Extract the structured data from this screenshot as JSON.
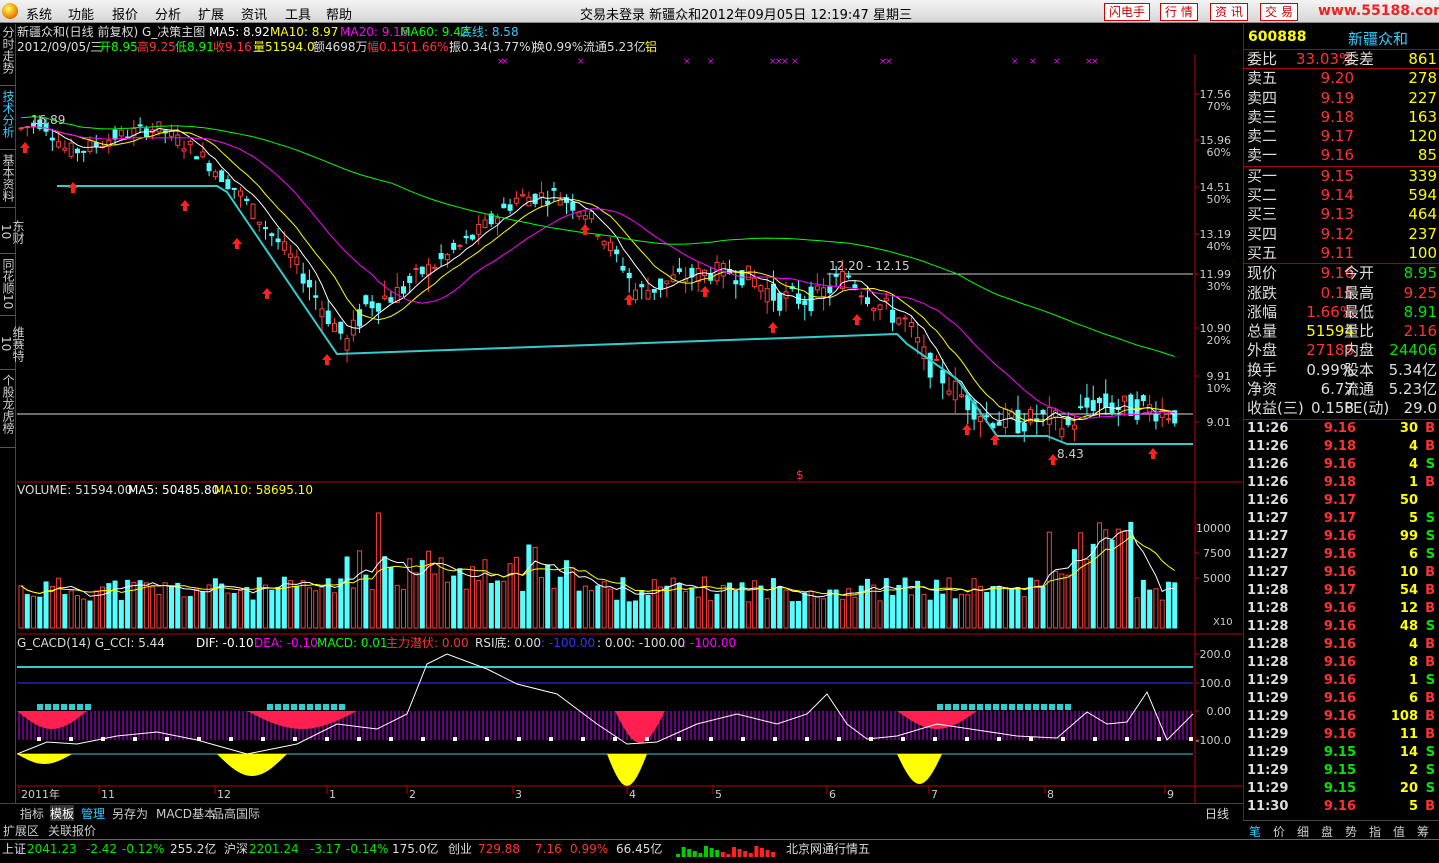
{
  "window": {
    "title": "交易未登录   新疆众和2012年09月05日  12:19:47  星期三"
  },
  "menu": [
    "系统",
    "功能",
    "报价",
    "分析",
    "扩展",
    "资讯",
    "工具",
    "帮助"
  ],
  "top_buttons": [
    "闪电手",
    "行  情",
    "资  讯",
    "交  易"
  ],
  "watermark": "www.55188.com",
  "left_tabs": [
    "分时走势",
    "技术分析",
    "基本资料",
    "东财10",
    "同花顺10",
    "维赛特10",
    "个股龙虎榜"
  ],
  "header": {
    "line1_prefix": "新疆众和(日线 前复权) G_决策主图",
    "ma5": "MA5: 8.92",
    "ma10": "MA10: 8.97",
    "ma20": "MA20: 9.16",
    "ma60": "MA60: 9.42",
    "bottom": "底线: 8.58",
    "line2_date": "2012/09/05/三",
    "open": "开8.95",
    "high": "高9.25",
    "low": "低8.91",
    "close": "收9.16",
    "vol": "量51594.0",
    "amt": "额4698万",
    "range": "幅0.15(1.66%)",
    "amp": "振0.34(3.77%)",
    "turn": "换0.99%",
    "float": "流通5.23亿",
    "alum": "铝"
  },
  "chart_data": [
    {
      "type": "candlestick",
      "title": "新疆众和(日线 前复权) G_决策主图",
      "y_ticks": [
        "17.56",
        "15.96",
        "14.51",
        "13.19",
        "11.99",
        "10.90",
        "9.91",
        "9.01"
      ],
      "pct_ticks": [
        "70%",
        "60%",
        "50%",
        "40%",
        "30%",
        "20%",
        "10%"
      ],
      "annotations": [
        "16.89",
        "12.20 - 12.15",
        "8.43",
        "$"
      ],
      "x_ticks": [
        "2011年",
        "11",
        "12",
        "1",
        "2",
        "3",
        "4",
        "5",
        "6",
        "7",
        "8",
        "9"
      ],
      "ma": [
        "MA5",
        "MA10",
        "MA20",
        "MA60"
      ]
    },
    {
      "type": "bar",
      "title": "VOLUME: 51594.00",
      "labels": [
        "MA5: 50485.80",
        "MA10: 58695.10"
      ],
      "y_ticks": [
        "10000",
        "7500",
        "5000"
      ],
      "scale": "X10"
    },
    {
      "type": "line",
      "title": "G_CACD(14)  G_CCI: 5.44",
      "labels": [
        "DIF: -0.10",
        "DEA: -0.10",
        "MACD: 0.01",
        "主力潜伏: 0.00",
        "RSI底: 0.00",
        ": -100.00",
        ": 0.00",
        ": -100.00",
        ": -100.00"
      ],
      "y_ticks": [
        "200.0",
        "100.0",
        "0.00",
        "-100.0"
      ]
    }
  ],
  "right_panel": {
    "code": "600888",
    "name": "新疆众和",
    "weibi": {
      "l1": "委比",
      "v1": "33.03%",
      "l2": "委差",
      "v2": "861"
    },
    "asks": [
      [
        "卖五",
        "9.20",
        "278"
      ],
      [
        "卖四",
        "9.19",
        "227"
      ],
      [
        "卖三",
        "9.18",
        "163"
      ],
      [
        "卖二",
        "9.17",
        "120"
      ],
      [
        "卖一",
        "9.16",
        "85"
      ]
    ],
    "bids": [
      [
        "买一",
        "9.15",
        "339"
      ],
      [
        "买二",
        "9.14",
        "594"
      ],
      [
        "买三",
        "9.13",
        "464"
      ],
      [
        "买四",
        "9.12",
        "237"
      ],
      [
        "买五",
        "9.11",
        "100"
      ]
    ],
    "stats": [
      [
        "现价",
        "9.16",
        "今开",
        "8.95"
      ],
      [
        "涨跌",
        "0.15",
        "最高",
        "9.25"
      ],
      [
        "涨幅",
        "1.66%",
        "最低",
        "8.91"
      ],
      [
        "总量",
        "51594",
        "量比",
        "2.16"
      ],
      [
        "外盘",
        "27188",
        "内盘",
        "24406"
      ],
      [
        "换手",
        "0.99%",
        "股本",
        "5.34亿"
      ],
      [
        "净资",
        "6.77",
        "流通",
        "5.23亿"
      ],
      [
        "收益(三)",
        "0.158",
        "PE(动)",
        "29.0"
      ]
    ],
    "ticks": [
      [
        "11:26",
        "9.16",
        "30",
        "B"
      ],
      [
        "11:26",
        "9.18",
        "4",
        "B"
      ],
      [
        "11:26",
        "9.16",
        "4",
        "S"
      ],
      [
        "11:26",
        "9.18",
        "1",
        "B"
      ],
      [
        "11:26",
        "9.17",
        "50",
        ""
      ],
      [
        "11:27",
        "9.17",
        "5",
        "S"
      ],
      [
        "11:27",
        "9.16",
        "99",
        "S"
      ],
      [
        "11:27",
        "9.16",
        "6",
        "S"
      ],
      [
        "11:27",
        "9.16",
        "10",
        "B"
      ],
      [
        "11:28",
        "9.17",
        "54",
        "B"
      ],
      [
        "11:28",
        "9.16",
        "12",
        "B"
      ],
      [
        "11:28",
        "9.16",
        "48",
        "S"
      ],
      [
        "11:28",
        "9.16",
        "4",
        "B"
      ],
      [
        "11:28",
        "9.16",
        "8",
        "B"
      ],
      [
        "11:29",
        "9.16",
        "1",
        "S"
      ],
      [
        "11:29",
        "9.16",
        "6",
        "B"
      ],
      [
        "11:29",
        "9.16",
        "108",
        "B"
      ],
      [
        "11:29",
        "9.16",
        "11",
        "B"
      ],
      [
        "11:29",
        "9.15",
        "14",
        "S"
      ],
      [
        "11:29",
        "9.15",
        "2",
        "S"
      ],
      [
        "11:29",
        "9.15",
        "20",
        "S"
      ],
      [
        "11:30",
        "9.16",
        "5",
        "B"
      ]
    ]
  },
  "bottom_tabs": [
    "指标",
    "模板",
    "管理",
    "另存为",
    "MACD基本",
    "品高国际"
  ],
  "period_label": "日线",
  "right_tabs": [
    "笔",
    "价",
    "细",
    "盘",
    "势",
    "指",
    "值",
    "筹"
  ],
  "status": [
    "扩展区",
    "关联报价"
  ],
  "footer": {
    "sh_label": "上证",
    "sh_val": "2041.23",
    "sh_chg": "-2.42",
    "sh_pct": "-0.12%",
    "sh_amt": "255.2亿",
    "sz_label": "沪深",
    "sz_val": "2201.24",
    "sz_chg": "-3.17",
    "sz_pct": "-0.14%",
    "sz_amt": "175.0亿",
    "cy_label": "创业",
    "cy_val": "729.88",
    "cy_chg": "7.16",
    "cy_pct": "0.99%",
    "cy_amt": "66.45亿",
    "provider": "北京网通行情五"
  }
}
